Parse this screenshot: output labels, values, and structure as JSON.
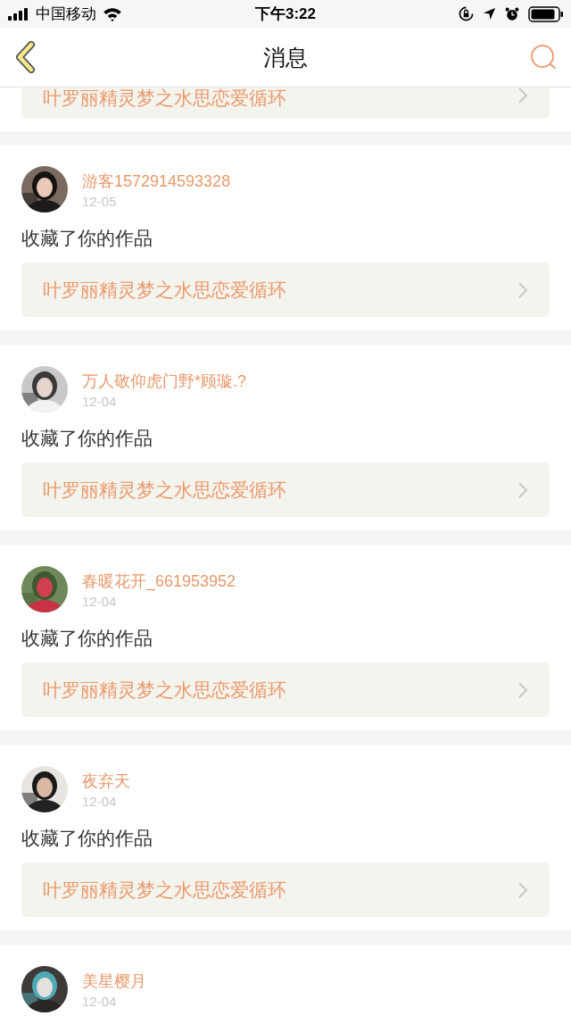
{
  "status_bar": {
    "carrier": "中国移动",
    "time": "下午3:22"
  },
  "header": {
    "title": "消息"
  },
  "partial_item": {
    "work": "叶罗丽精灵梦之水思恋爱循环"
  },
  "items": [
    {
      "user": "游客1572914593328",
      "date": "12-05",
      "action": "收藏了你的作品",
      "work": "叶罗丽精灵梦之水思恋爱循环"
    },
    {
      "user": "万人敬仰虎门野*顾璇.?",
      "date": "12-04",
      "action": "收藏了你的作品",
      "work": "叶罗丽精灵梦之水思恋爱循环"
    },
    {
      "user": "春暖花开_661953952",
      "date": "12-04",
      "action": "收藏了你的作品",
      "work": "叶罗丽精灵梦之水思恋爱循环"
    },
    {
      "user": "夜弃天",
      "date": "12-04",
      "action": "收藏了你的作品",
      "work": "叶罗丽精灵梦之水思恋爱循环"
    },
    {
      "user": "美星樱月",
      "date": "12-04"
    }
  ]
}
